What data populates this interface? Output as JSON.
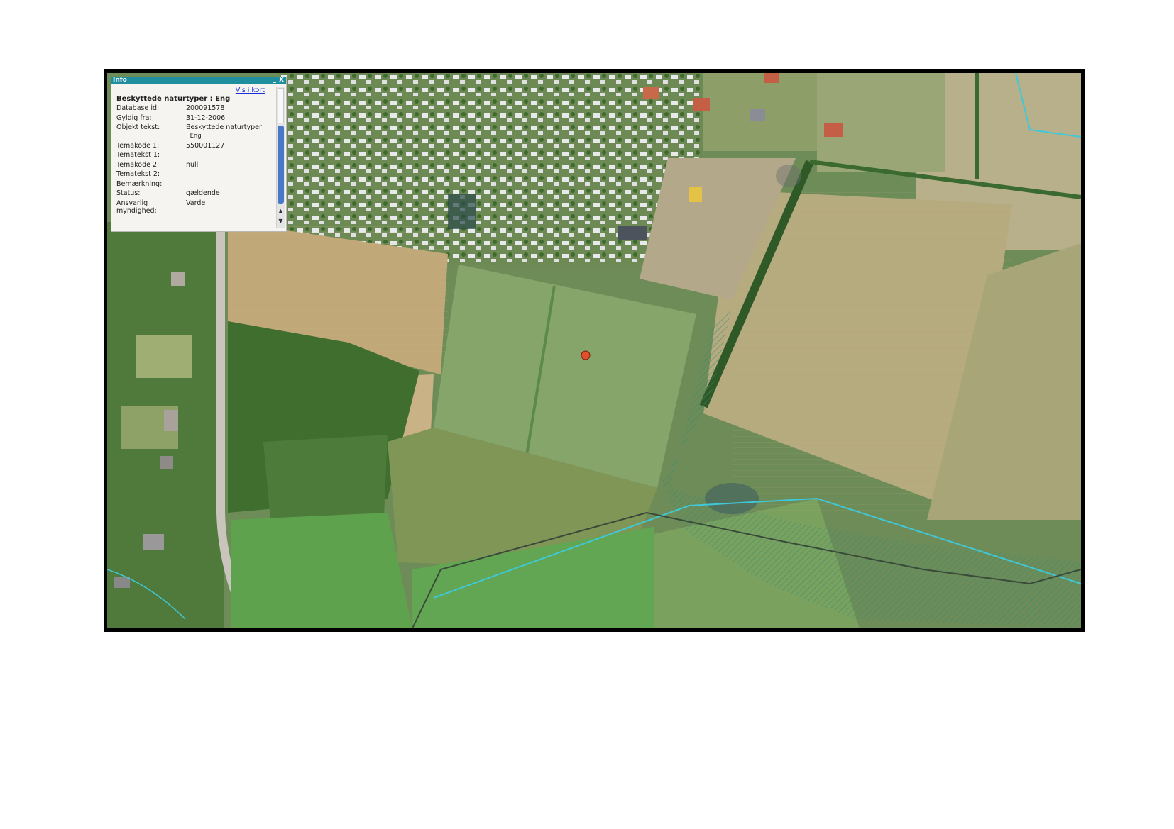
{
  "info_window": {
    "title": "Info",
    "minimize_label": "_",
    "close_label": "X",
    "link_label": "Vis i kort",
    "heading": "Beskyttede naturtyper : Eng",
    "rows": [
      {
        "label": "Database id:",
        "value": "200091578"
      },
      {
        "label": "Gyldig fra:",
        "value": "31-12-2006"
      },
      {
        "label": "Objekt tekst:",
        "value": "Beskyttede naturtyper",
        "value2": ": Eng"
      },
      {
        "label": "Temakode 1:",
        "value": "550001127"
      },
      {
        "label": "Tematekst 1:",
        "value": ""
      },
      {
        "label": "Temakode 2:",
        "value": "null"
      },
      {
        "label": "Tematekst 2:",
        "value": ""
      },
      {
        "label": "Bemærkning:",
        "value": ""
      },
      {
        "label": "Status:",
        "value": "gældende"
      },
      {
        "label": "Ansvarlig",
        "label2": "myndighed:",
        "value": "Varde"
      }
    ],
    "scroll_up": "▲",
    "scroll_down": "▼"
  },
  "map": {
    "marker_color": "#e2502a",
    "watercourse_color": "#3fc8d8"
  }
}
